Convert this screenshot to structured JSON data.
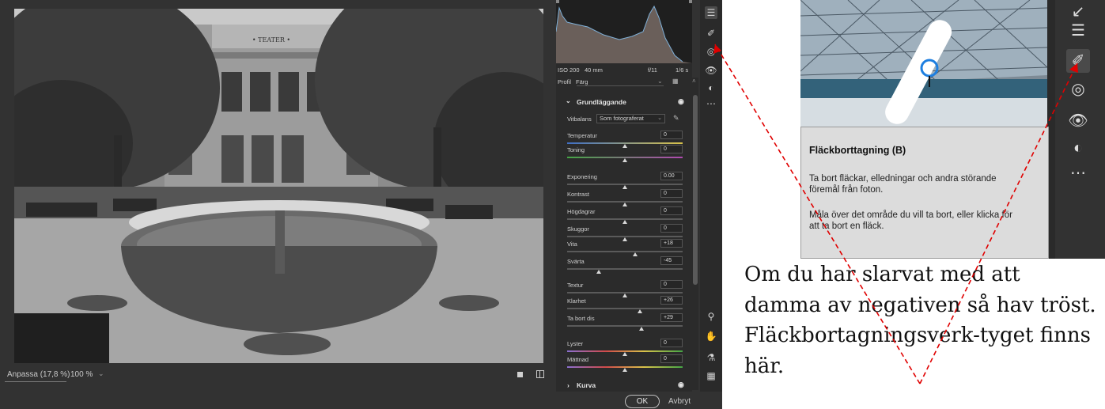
{
  "histogram_info": {
    "iso": "ISO 200",
    "focal": "40 mm",
    "aperture": "f/11",
    "shutter": "1/6 s"
  },
  "profile": {
    "label": "Profil",
    "value": "Färg"
  },
  "basic": {
    "title": "Grundläggande",
    "white_balance_label": "Vitbalans",
    "white_balance_value": "Som fotograferat",
    "sliders": [
      {
        "label": "Temperatur",
        "value": "0",
        "position": 0.5
      },
      {
        "label": "Toning",
        "value": "0",
        "position": 0.5
      },
      {
        "label": "Exponering",
        "value": "0.00",
        "position": 0.5
      },
      {
        "label": "Kontrast",
        "value": "0",
        "position": 0.5
      },
      {
        "label": "Högdagrar",
        "value": "0",
        "position": 0.5
      },
      {
        "label": "Skuggor",
        "value": "0",
        "position": 0.5
      },
      {
        "label": "Vita",
        "value": "+18",
        "position": 0.59
      },
      {
        "label": "Svärta",
        "value": "-45",
        "position": 0.275
      },
      {
        "label": "Textur",
        "value": "0",
        "position": 0.5
      },
      {
        "label": "Klarhet",
        "value": "+26",
        "position": 0.63
      },
      {
        "label": "Ta bort dis",
        "value": "+29",
        "position": 0.645
      },
      {
        "label": "Lyster",
        "value": "0",
        "position": 0.5
      },
      {
        "label": "Mättnad",
        "value": "0",
        "position": 0.5
      }
    ]
  },
  "curve": {
    "title": "Kurva"
  },
  "zoom": {
    "fit_label": "Anpassa (17,8 %)",
    "percent": "100 %"
  },
  "buttons": {
    "ok": "OK",
    "cancel": "Avbryt"
  },
  "photo_sign": "• TEATER •",
  "tooltip": {
    "title": "Fläckborttagning (B)",
    "body1": "Ta bort fläckar, elledningar och andra störande föremål från foton.",
    "body2": "Måla över det område du vill ta bort, eller klicka för att ta bort en fläck."
  },
  "note": "Om du har slarvat med att damma av negativen så hav tröst. Fläckbortagningsverk-tyget finns här.",
  "icons": {
    "tool_edit": "sliders-icon",
    "tool_heal": "bandage-icon",
    "tool_mask": "mask-icon",
    "tool_redeye": "red-eye-icon",
    "tool_presets": "presets-icon",
    "tool_more": "more-icon",
    "tool_zoom": "zoom-icon",
    "tool_hand": "hand-icon",
    "tool_sampler": "color-sampler-icon",
    "tool_grid": "grid-icon"
  },
  "colors": {
    "arrow": "#e00000",
    "panel": "#2b2b2b",
    "window": "#323232"
  }
}
